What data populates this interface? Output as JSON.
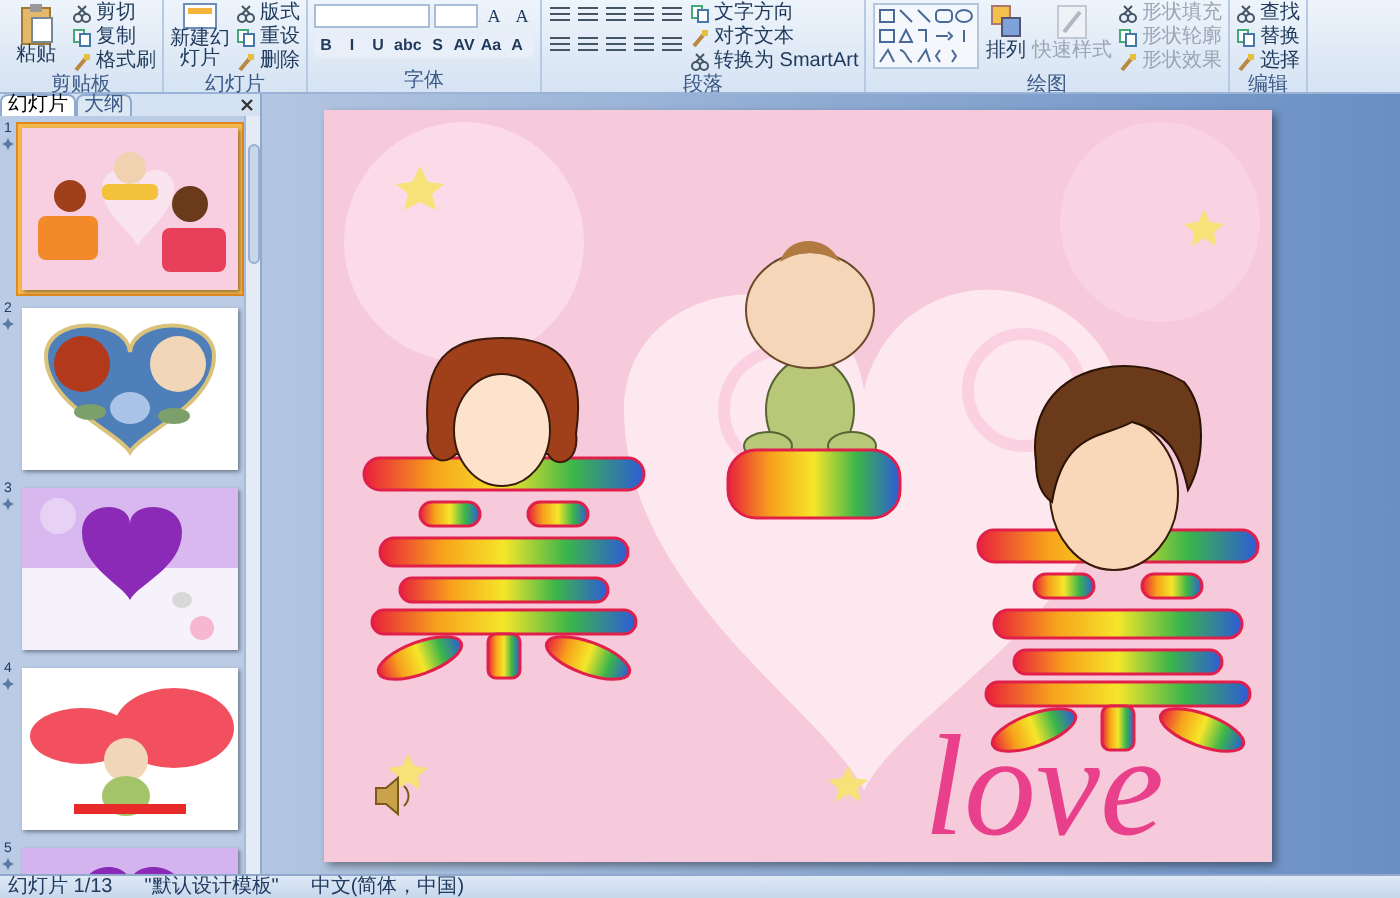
{
  "ribbon": {
    "groups": [
      {
        "kind": "buttons",
        "label": "剪贴板",
        "large": {
          "label": "粘贴"
        },
        "commands": [
          "剪切",
          "复制",
          "格式刷"
        ]
      },
      {
        "kind": "buttons",
        "label": "幻灯片",
        "large": {
          "label": "新建幻灯片"
        },
        "commands": [
          "版式",
          "重设",
          "删除"
        ]
      },
      {
        "kind": "font",
        "label": "字体",
        "top_buttons": [
          "A",
          "A"
        ],
        "format_buttons": [
          "B",
          "I",
          "U",
          "abc",
          "S",
          "AV",
          "Aa",
          "A"
        ]
      },
      {
        "kind": "paragraph",
        "label": "段落",
        "commands": [
          "文字方向",
          "对齐文本",
          "转换为 SmartArt"
        ]
      },
      {
        "kind": "drawing",
        "label": "绘图",
        "large": [
          {
            "label": "排列",
            "disabled": false
          },
          {
            "label": "快速样式",
            "disabled": true
          }
        ],
        "commands": [
          {
            "label": "形状填充",
            "disabled": true
          },
          {
            "label": "形状轮廓",
            "disabled": true
          },
          {
            "label": "形状效果",
            "disabled": true
          }
        ]
      },
      {
        "kind": "buttons",
        "label": "编辑",
        "commands": [
          "查找",
          "替换",
          "选择"
        ]
      }
    ]
  },
  "slide_panel": {
    "tabs": [
      {
        "label": "幻灯片",
        "selected": true
      },
      {
        "label": "大纲",
        "selected": false
      }
    ],
    "slides": [
      {
        "number": "1",
        "selected": true
      },
      {
        "number": "2",
        "selected": false
      },
      {
        "number": "3",
        "selected": false
      },
      {
        "number": "4",
        "selected": false
      },
      {
        "number": "5",
        "selected": false
      }
    ]
  },
  "slide": {
    "caption": "love"
  },
  "status_bar": [
    "幻灯片 1/13",
    "\"默认设计模板\"",
    "中文(简体，中国)"
  ]
}
